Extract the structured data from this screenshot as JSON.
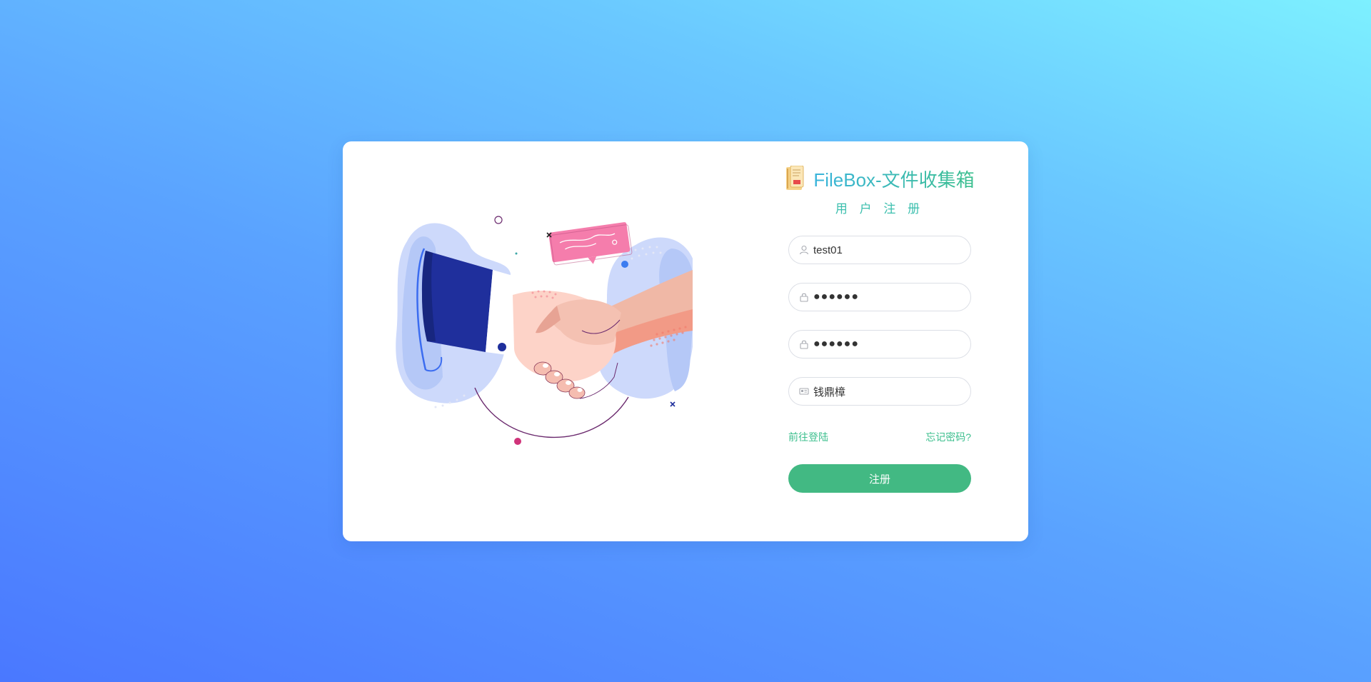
{
  "brand": {
    "title": "FileBox-文件收集箱",
    "icon": "document-folder-icon"
  },
  "subtitle": "用 户 注 册",
  "form": {
    "username": {
      "value": "test01",
      "icon": "user-icon"
    },
    "password": {
      "value": "●●●●●●",
      "icon": "lock-icon"
    },
    "confirm_password": {
      "value": "●●●●●●",
      "icon": "lock-icon"
    },
    "real_name": {
      "value": "钱鼎樟",
      "icon": "id-card-icon"
    }
  },
  "links": {
    "login": "前往登陆",
    "forgot": "忘记密码?"
  },
  "submit_label": "注册",
  "colors": {
    "accent": "#42b983",
    "title_start": "#3ab4dc",
    "title_end": "#3cbf8e",
    "bg_start": "#4a78ff",
    "bg_end": "#7df0ff"
  },
  "illustration": "handshake-illustration"
}
